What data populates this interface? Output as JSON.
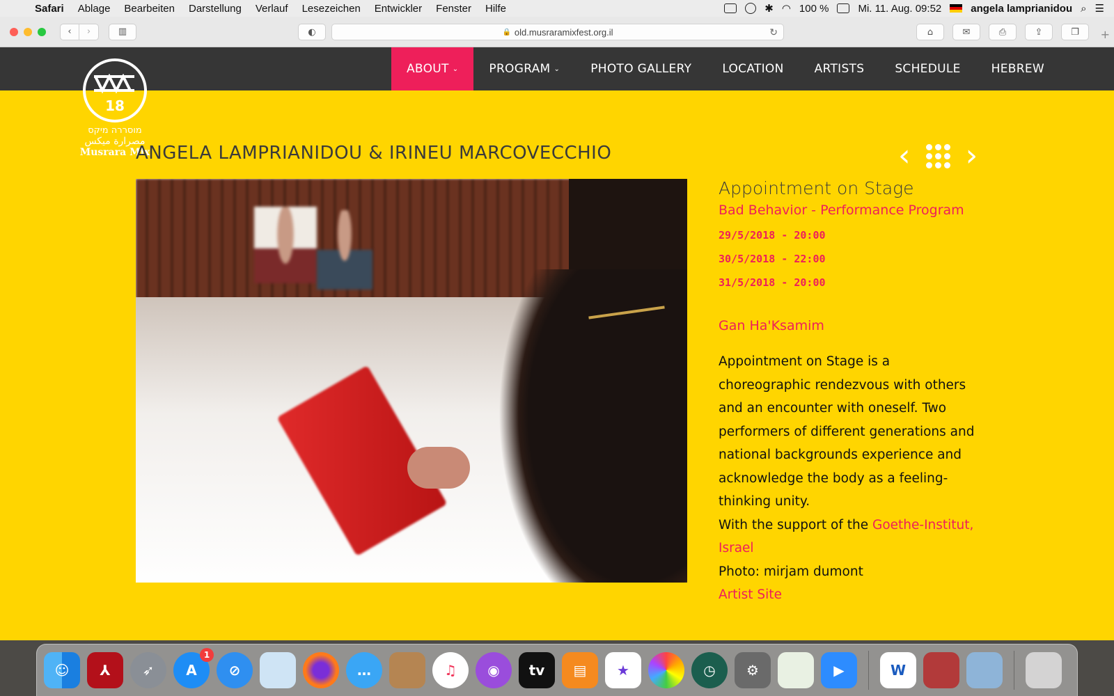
{
  "menubar": {
    "apple": "",
    "app": "Safari",
    "items": [
      "Ablage",
      "Bearbeiten",
      "Darstellung",
      "Verlauf",
      "Lesezeichen",
      "Entwickler",
      "Fenster",
      "Hilfe"
    ],
    "battery": "100 %",
    "datetime": "Mi. 11. Aug.  09:52",
    "user": "angela lamprianidou"
  },
  "toolbar": {
    "url": "old.musraramixfest.org.il"
  },
  "nav": {
    "items": [
      {
        "label": "ABOUT",
        "caret": "⌄"
      },
      {
        "label": "PROGRAM",
        "caret": "⌄"
      },
      {
        "label": "PHOTO GALLERY"
      },
      {
        "label": "LOCATION"
      },
      {
        "label": "ARTISTS"
      },
      {
        "label": "SCHEDULE"
      },
      {
        "label": "HEBREW"
      }
    ]
  },
  "logo": {
    "number": "18",
    "hebrew": "מוסררה מיקס",
    "arabic": "مصرارة ميكس",
    "english": "Musrara Mix"
  },
  "page": {
    "title": "ANGELA LAMPRIANIDOU & IRINEU MARCOVECCHIO",
    "pager_prev": "‹",
    "pager_next": "›"
  },
  "info": {
    "show_title": "Appointment on Stage",
    "program": "Bad Behavior - Performance Program",
    "dates": [
      "29/5/2018 - 20:00",
      "30/5/2018 - 22:00",
      "31/5/2018 - 20:00"
    ],
    "venue": "Gan Ha'Ksamim",
    "description": "Appointment on Stage is a choreographic rendezvous with others and an encounter with oneself. Two performers of different generations and national backgrounds experience and acknowledge the body as a feeling-thinking unity.",
    "support_prefix": "With the support of the ",
    "support_link": "Goethe-Institut, Israel",
    "photo_credit": "Photo: mirjam dumont",
    "artist_link": "Artist Site"
  },
  "dock": {
    "appstore_badge": "1",
    "tv_label": "tv",
    "word_label": "W"
  },
  "colors": {
    "accent": "#ee1f5a",
    "background": "#ffd500",
    "header": "#363636"
  }
}
